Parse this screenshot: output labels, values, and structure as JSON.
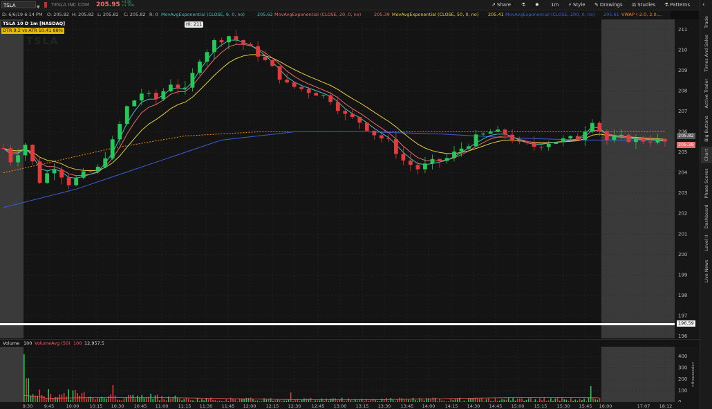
{
  "header": {
    "symbol": "TSLA",
    "company": "TESLA INC COM",
    "last_price": "205.95",
    "change_top": "+3.56",
    "change_bottom": "+1.75%",
    "toolbar": {
      "share": "Share",
      "interval": "1m",
      "style": "Style",
      "drawings": "Drawings",
      "studies": "Studies",
      "patterns": "Patterns"
    }
  },
  "studies_bar": {
    "ohlc": {
      "date": "D: 6/6/19 6:14 PM",
      "open": "O: 205.82",
      "high": "H: 205.82",
      "low": "L: 205.82",
      "close": "C: 205.82",
      "range": "R: 0"
    },
    "ema9": {
      "label": "MovAvgExponential (CLOSE, 9, 0, no)",
      "value": "205.62",
      "color": "#3fc2c2"
    },
    "ema20": {
      "label": "MovAvgExponential (CLOSE, 20, 0, no)",
      "value": "205.39",
      "color": "#e66b6b"
    },
    "ema50": {
      "label": "MovAvgExponential (CLOSE, 50, 0, no)",
      "value": "205.41",
      "color": "#e6d040"
    },
    "ema200": {
      "label": "MovAvgExponential (CLOSE, 200, 0, no)",
      "value": "205.61",
      "color": "#3b5fd9"
    },
    "vwap": {
      "label": "VWAP (-2.0, 2.0,...",
      "color": "#ff8c00"
    }
  },
  "chart_header": {
    "title": "TSLA 10 D 1m [NASDAQ]",
    "dtr": "DTR 9.2 vs ATR 10.41",
    "dtr_pct": "88%",
    "watermark": "TSLA",
    "hi_label": "Hi: 211"
  },
  "price_axis": {
    "ticks": [
      "211",
      "210",
      "209",
      "208",
      "207",
      "206",
      "205",
      "204",
      "203",
      "202",
      "201",
      "200",
      "199",
      "198",
      "197",
      "196"
    ],
    "labels": {
      "last": "205.82",
      "ema20": "205.39",
      "line": "196.59"
    }
  },
  "time_axis": {
    "ticks": [
      "9:30",
      "9:45",
      "10:00",
      "10:15",
      "10:30",
      "10:45",
      "11:00",
      "11:15",
      "11:30",
      "11:45",
      "12:00",
      "12:15",
      "12:30",
      "12:45",
      "13:00",
      "13:15",
      "13:30",
      "13:45",
      "14:00",
      "14:15",
      "14:30",
      "14:45",
      "15:00",
      "15:15",
      "15:30",
      "15:45",
      "16:00",
      "17:07",
      "18:12"
    ]
  },
  "volume": {
    "label": "Volume",
    "val1": "100",
    "avg_label": "VolumeAvg (50)",
    "val2": "100",
    "val3": "12,957.5",
    "ticks": [
      "400",
      "300",
      "200",
      "100",
      "0"
    ],
    "unit": "<thousands>"
  },
  "right_tabs": [
    "Trade",
    "Times And Sales",
    "Active Trader",
    "Big Buttons",
    "Chart",
    "Phase Scores",
    "Dashboard",
    "Level II",
    "Live News"
  ],
  "chart_data": {
    "type": "candlestick",
    "x_ticks": [
      "9:30",
      "9:45",
      "10:00",
      "10:15",
      "10:30",
      "10:45",
      "11:00",
      "11:15",
      "11:30",
      "11:45",
      "12:00",
      "12:15",
      "12:30",
      "12:45",
      "13:00",
      "13:15",
      "13:30",
      "13:45",
      "14:00",
      "14:15",
      "14:30",
      "14:45",
      "15:00",
      "15:15",
      "15:30",
      "15:45",
      "16:00",
      "17:07",
      "18:12"
    ],
    "ylim": [
      196,
      211.5
    ],
    "close_anchors": [
      [
        0,
        205.2
      ],
      [
        1,
        204.6
      ],
      [
        3,
        205.4
      ],
      [
        5,
        203.6
      ],
      [
        7,
        204.3
      ],
      [
        9,
        203.5
      ],
      [
        11,
        203.9
      ],
      [
        13,
        204.2
      ],
      [
        15,
        205.5
      ],
      [
        17,
        207.2
      ],
      [
        19,
        207.9
      ],
      [
        21,
        207.6
      ],
      [
        23,
        208.4
      ],
      [
        25,
        208.0
      ],
      [
        27,
        209.6
      ],
      [
        29,
        210.4
      ],
      [
        31,
        210.7
      ],
      [
        33,
        210.3
      ],
      [
        35,
        209.8
      ],
      [
        37,
        209.1
      ],
      [
        39,
        208.3
      ],
      [
        41,
        208.1
      ],
      [
        43,
        207.9
      ],
      [
        45,
        207.6
      ],
      [
        47,
        206.8
      ],
      [
        49,
        206.5
      ],
      [
        51,
        205.9
      ],
      [
        53,
        205.5
      ],
      [
        55,
        204.6
      ],
      [
        57,
        204.2
      ],
      [
        59,
        204.5
      ],
      [
        61,
        204.7
      ],
      [
        63,
        205.2
      ],
      [
        65,
        205.7
      ],
      [
        67,
        206.0
      ],
      [
        69,
        205.9
      ],
      [
        71,
        205.4
      ],
      [
        73,
        205.3
      ],
      [
        75,
        205.5
      ],
      [
        77,
        205.6
      ],
      [
        79,
        205.7
      ],
      [
        81,
        206.6
      ],
      [
        83,
        205.6
      ],
      [
        85,
        205.7
      ],
      [
        87,
        205.6
      ],
      [
        89,
        205.6
      ],
      [
        91,
        205.5
      ]
    ],
    "ema200_anchors": [
      [
        0,
        202.3
      ],
      [
        10,
        203.2
      ],
      [
        20,
        204.4
      ],
      [
        30,
        205.6
      ],
      [
        40,
        206.0
      ],
      [
        50,
        206.0
      ],
      [
        60,
        205.9
      ],
      [
        70,
        205.7
      ],
      [
        80,
        205.6
      ],
      [
        91,
        205.6
      ]
    ],
    "vwap_anchors": [
      [
        0,
        204.0
      ],
      [
        15,
        205.2
      ],
      [
        25,
        205.8
      ],
      [
        35,
        206.0
      ],
      [
        50,
        206.0
      ],
      [
        70,
        206.0
      ],
      [
        91,
        206.0
      ]
    ],
    "horizontal_line": 196.59,
    "volume_peaks_thousands": [
      420,
      160,
      120,
      95,
      150,
      110,
      90,
      80,
      140
    ],
    "volume_ylim": [
      0,
      450
    ]
  }
}
